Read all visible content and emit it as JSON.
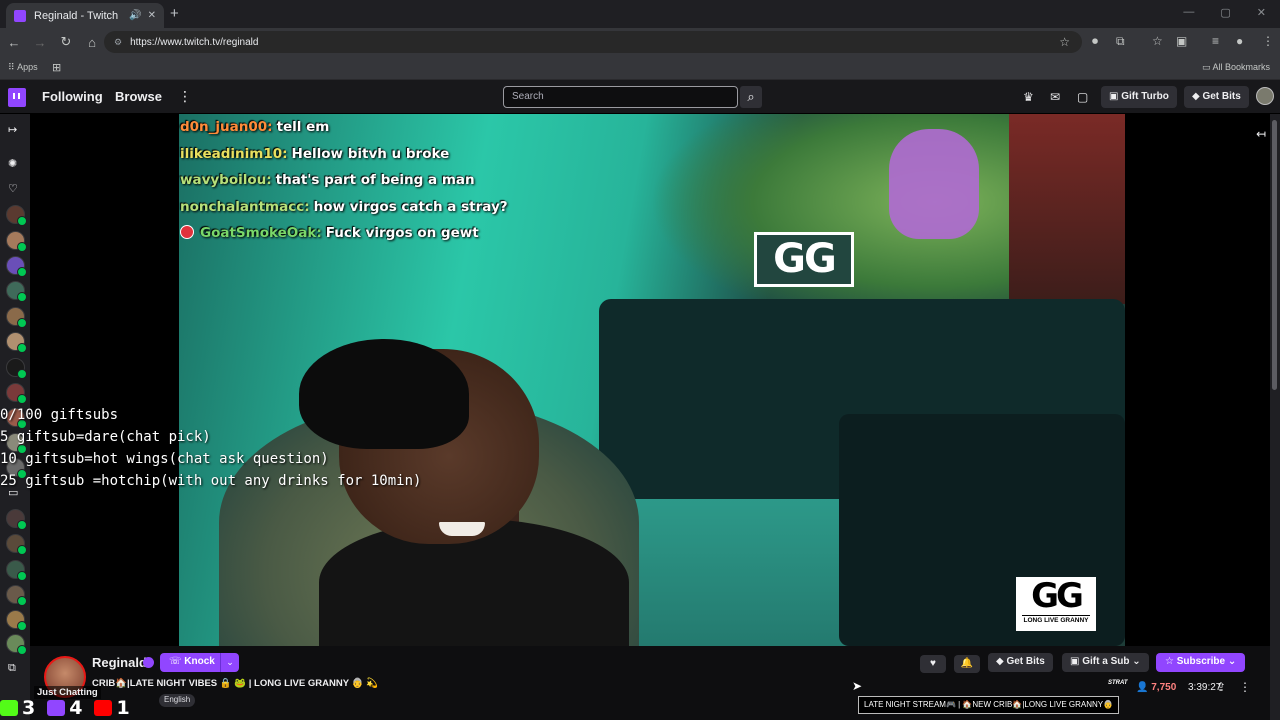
{
  "browser": {
    "tab_title": "Reginald - Twitch",
    "url": "https://www.twitch.tv/reginald",
    "bookmarks": {
      "apps": "Apps",
      "all": "All Bookmarks"
    }
  },
  "nav": {
    "following": "Following",
    "browse": "Browse",
    "search_placeholder": "Search",
    "gift_turbo": "Gift Turbo",
    "get_bits": "Get Bits"
  },
  "chat_overlay": [
    {
      "user": "d0n_juan00:",
      "user_color": "#ff8c3a",
      "text": "tell em"
    },
    {
      "user": "ilikeadinim10:",
      "user_color": "#e8e060",
      "text": "Hellow bitvh u broke"
    },
    {
      "user": "wavyboilou:",
      "user_color": "#b6e07a",
      "text": "that's part of being a man"
    },
    {
      "user": "nonchalantmacc:",
      "user_color": "#b6e07a",
      "text": "how virgos catch a stray?"
    },
    {
      "user": "GoatSmokeOak:",
      "user_color": "#7ad86a",
      "text": "Fuck virgos on gewt",
      "badge": true
    }
  ],
  "gift_overlay": [
    "0/100 giftsubs",
    "5 giftsub=dare(chat pick)",
    "10 giftsub=hot wings(chat ask question)",
    "25 giftsub =hotchip(with out any drinks for 10min)"
  ],
  "overlay_logo": {
    "big": "GG",
    "small": "LONG LIVE GRANNY"
  },
  "wall_logo": "GG",
  "stream": {
    "name": "Reginald",
    "knock": "Knock",
    "title": "NEW CRIB🏠|LATE NIGHT VIBES 🔒 🐸 | LONG LIVE GRANNY 👵 💫",
    "title_visible": "CRIB🏠|LATE NIGHT VIBES 🔒 🐸 | LONG LIVE GRANNY 👵 💫",
    "category": "Just Chatting",
    "language": "English",
    "get_bits": "Get Bits",
    "gift_sub": "Gift a Sub",
    "subscribe": "Subscribe",
    "viewers": "7,750",
    "uptime": "3:39:27",
    "ticker": "LATE NIGHT STREAM🎮 | 🏠NEW CRIB🏠|LONG LIVE GRANNY👵"
  },
  "socials": [
    {
      "platform": "kick",
      "count": "3",
      "color": "#53fc18"
    },
    {
      "platform": "twitch",
      "count": "4",
      "color": "#9146ff"
    },
    {
      "platform": "youtube",
      "count": "1",
      "color": "#ff0000"
    }
  ]
}
